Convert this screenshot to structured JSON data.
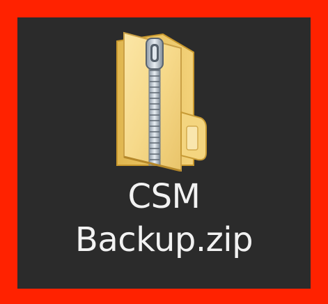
{
  "desktop": {
    "selection_color": "#ff2200",
    "background_color": "#2b2b2b",
    "item": {
      "icon": "zip-folder-icon",
      "name_line1": "CSM",
      "name_line2": "Backup.zip"
    }
  }
}
